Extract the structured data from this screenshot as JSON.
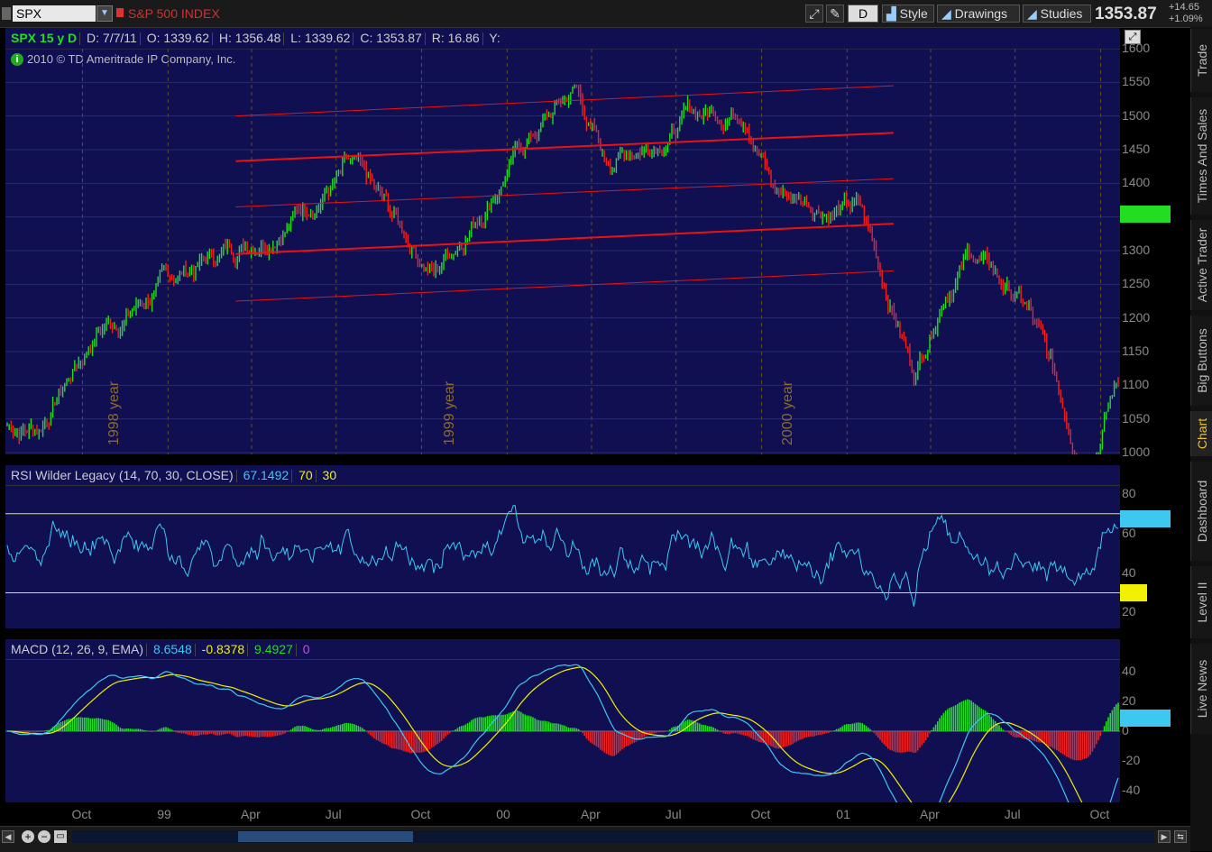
{
  "toolbar": {
    "symbol": "SPX",
    "name": "S&P 500 INDEX",
    "aggregation": "D",
    "style_label": "Style",
    "drawings_label": "Drawings",
    "studies_label": "Studies",
    "last_price": "1353.87",
    "net_change": "+14.65",
    "pct_change": "+1.09%"
  },
  "header": {
    "symbol_period": "SPX 15 y D",
    "date": "D: 7/7/11",
    "open": "O: 1339.62",
    "high": "H: 1356.48",
    "low": "L: 1339.62",
    "close": "C: 1353.87",
    "range": "R: 16.86",
    "y": "Y:",
    "copyright": "2010 © TD Ameritrade IP Company, Inc."
  },
  "side_tabs": [
    "Trade",
    "Times And Sales",
    "Active Trader",
    "Big Buttons",
    "Chart",
    "Dashboard",
    "Level II",
    "Live News"
  ],
  "colors": {
    "panel": "#0f0f52",
    "up": "#22dd22",
    "down": "#ee2222",
    "rsi": "#3ec8f0",
    "macd_avg": "#f0f000",
    "channel": "#ee1111"
  },
  "price_panel": {
    "y_ticks": [
      "1600",
      "1550",
      "1500",
      "1450",
      "1400",
      "1350",
      "1300",
      "1250",
      "1200",
      "1150",
      "1100",
      "1050",
      "1000"
    ],
    "last_badge": "1353.87",
    "year_labels": [
      "1998 year",
      "1999 year",
      "2000 year"
    ]
  },
  "rsi_panel": {
    "title": "RSI Wilder Legacy (14, 70, 30, CLOSE)",
    "value": "67.1492",
    "overbought": "70",
    "oversold": "30",
    "y_ticks": [
      "80",
      "60",
      "40",
      "20"
    ],
    "value_badge": "67.149",
    "oversold_badge": "30"
  },
  "macd_panel": {
    "title": "MACD (12, 26, 9, EMA)",
    "value": "8.6548",
    "avg": "-0.8378",
    "diff": "9.4927",
    "zero": "0",
    "y_ticks": [
      "40",
      "20",
      "0",
      "-20",
      "-40"
    ],
    "value_badge": "8.6548"
  },
  "x_axis": [
    "Oct",
    "99",
    "Apr",
    "Jul",
    "Oct",
    "00",
    "Apr",
    "Jul",
    "Oct",
    "01",
    "Apr",
    "Jul",
    "Oct"
  ],
  "chart_data": {
    "type": "line",
    "title": "SPX 15 y D",
    "x": [
      "1998-08",
      "1998-10",
      "1999-01",
      "1999-04",
      "1999-07",
      "1999-10",
      "2000-01",
      "2000-03",
      "2000-04",
      "2000-07",
      "2000-09",
      "2000-10",
      "2001-01",
      "2001-03",
      "2001-04",
      "2001-05",
      "2001-07",
      "2001-09",
      "2001-10",
      "2001-12"
    ],
    "series": [
      {
        "values": [
          1040,
          1180,
          1265,
          1330,
          1420,
          1270,
          1450,
          1540,
          1430,
          1500,
          1520,
          1390,
          1360,
          1120,
          1250,
          1300,
          1210,
          980,
          1100,
          1150
        ]
      }
    ],
    "ylim": [
      1000,
      1600
    ],
    "rsi": {
      "overbought": 70,
      "oversold": 30,
      "last": 67.1492
    },
    "macd": {
      "value": 8.6548,
      "avg": -0.8378,
      "diff": 9.4927
    }
  }
}
